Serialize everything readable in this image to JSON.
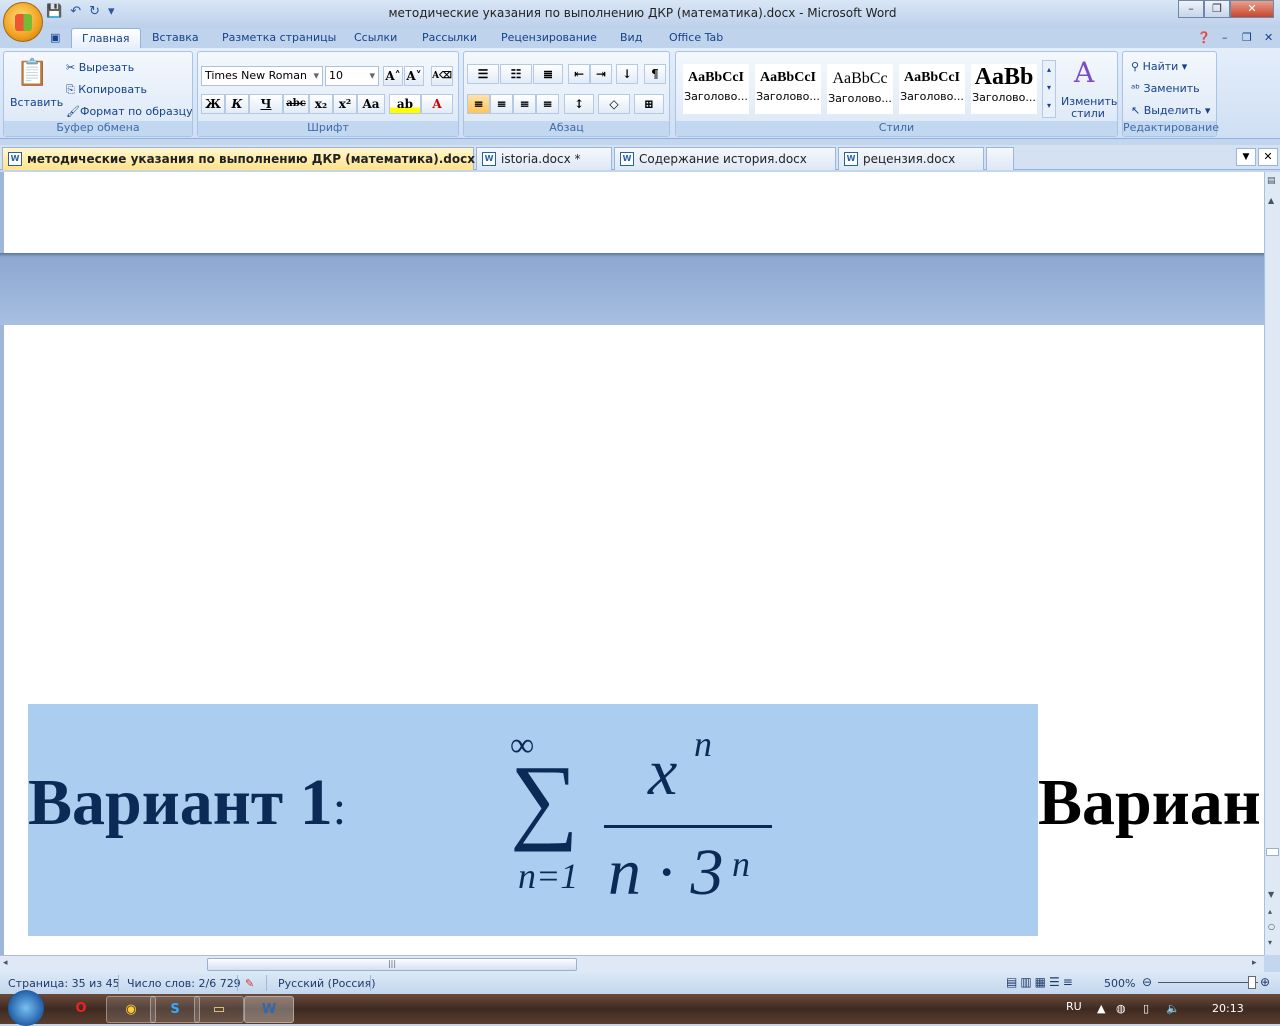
{
  "window": {
    "title": "методические указания по выполнению ДКР (математика).docx - Microsoft Word"
  },
  "ribbon_tabs": [
    "Главная",
    "Вставка",
    "Разметка страницы",
    "Ссылки",
    "Рассылки",
    "Рецензирование",
    "Вид",
    "Office Tab"
  ],
  "clipboard": {
    "paste": "Вставить",
    "cut": "Вырезать",
    "copy": "Копировать",
    "format_painter": "Формат по образцу",
    "label": "Буфер обмена"
  },
  "font": {
    "name": "Times New Roman",
    "size": "10",
    "label": "Шрифт",
    "bold": "Ж",
    "italic": "К",
    "underline": "Ч",
    "strike": "abc",
    "sub": "x₂",
    "sup": "x²",
    "case": "Aa",
    "grow": "A˄",
    "shrink": "A˅",
    "color_letter": "A"
  },
  "paragraph": {
    "label": "Абзац",
    "pilcrow": "¶"
  },
  "styles": {
    "label": "Стили",
    "items": [
      {
        "sample": "AaBbCcI",
        "name": "Заголово..."
      },
      {
        "sample": "AaBbCcI",
        "name": "Заголово..."
      },
      {
        "sample": "AaBbCc",
        "name": "Заголово..."
      },
      {
        "sample": "AaBbCcI",
        "name": "Заголово..."
      },
      {
        "sample": "AaBb",
        "name": "Заголово..."
      }
    ],
    "change": "Изменить стили"
  },
  "editing": {
    "label": "Редактирование",
    "find": "Найти",
    "replace": "Заменить",
    "select": "Выделить"
  },
  "doc_tabs": [
    {
      "label": "методические указания по выполнению ДКР (математика).docx *",
      "active": true
    },
    {
      "label": "istoria.docx *"
    },
    {
      "label": "Содержание история.docx"
    },
    {
      "label": "рецензия.docx"
    }
  ],
  "document": {
    "variant1": "Вариант  1",
    "colon": ":",
    "variant2": "Вариан",
    "formula": {
      "upper": "∞",
      "lower": "n=1",
      "numerator_base": "x",
      "numerator_exp": "n",
      "denominator": "n · 3",
      "denominator_exp": "n",
      "sigma": "∑"
    }
  },
  "status": {
    "page": "Страница: 35 из 45",
    "words": "Число слов: 2/6 729",
    "language": "Русский (Россия)",
    "zoom": "500%",
    "zoom_percent": 500
  },
  "taskbar": {
    "lang": "RU",
    "time": "20:13"
  },
  "colors": {
    "highlight": "#abcdef",
    "accent": "#15428b"
  }
}
